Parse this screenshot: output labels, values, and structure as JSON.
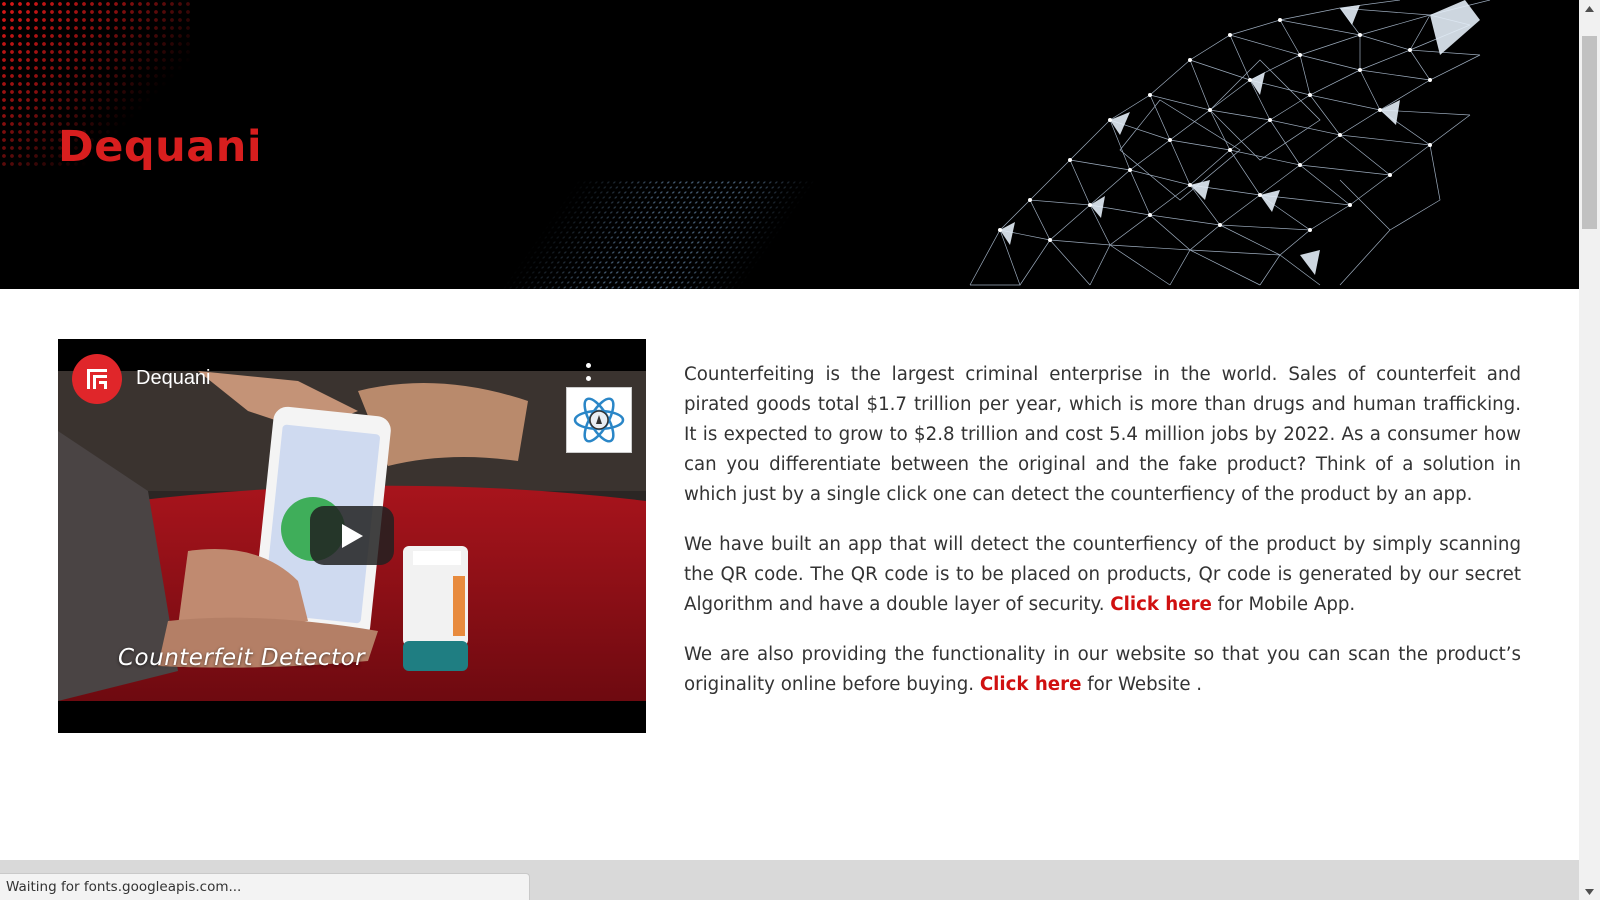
{
  "hero": {
    "title": "Dequani",
    "accent_color": "#d81e1e"
  },
  "video": {
    "channel_name": "Dequani",
    "caption": "Counterfeit Detector",
    "icons": [
      "channel-logo-icon",
      "more-vert-icon",
      "atom-watermark-icon",
      "play-icon"
    ]
  },
  "article": {
    "p1": "Counterfeiting is the largest criminal enterprise in the world. Sales of counterfeit and pirated goods total $1.7 trillion per year, which is more than drugs and human trafficking. It is expected to grow to $2.8 trillion and cost 5.4 million jobs by 2022. As a consumer how can you differentiate between the original and the fake product? Think of a solution in which just by a single click one can detect the counterfiency of the product by an app.",
    "p2_before": "We have built an app that will detect the counterfiency of the product by simply scanning the QR code. The QR code is to be placed on products, Qr code is generated by our secret Algorithm and have a double layer of security. ",
    "p2_link": "Click here",
    "p2_after": " for Mobile App.",
    "p3_before": "We are also providing the functionality in our website so that you can scan the product’s originality online before buying. ",
    "p3_link": "Click here",
    "p3_after": " for Website .",
    "link_color": "#d01010"
  },
  "status_bar": {
    "text": "Waiting for fonts.googleapis.com..."
  },
  "scrollbar": {
    "up_icon": "triangle-up-icon",
    "down_icon": "triangle-down-icon"
  }
}
